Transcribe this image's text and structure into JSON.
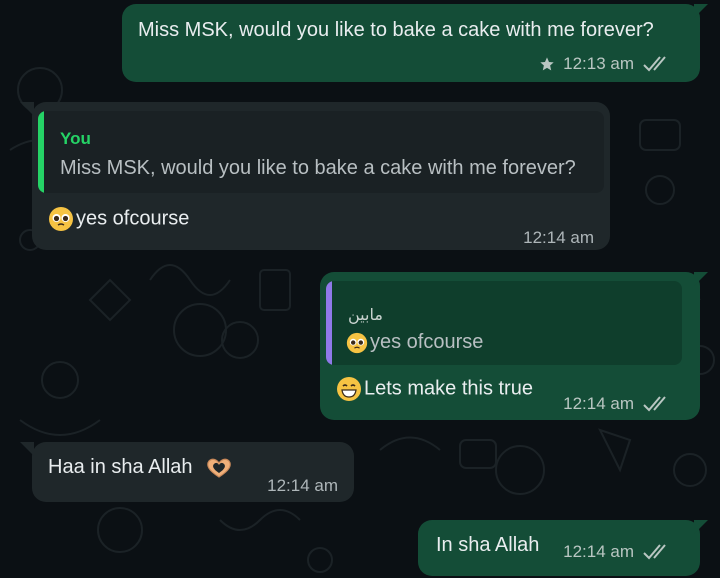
{
  "colors": {
    "outgoing_bubble": "#144d37",
    "incoming_bubble": "#1f272a",
    "background": "#0b1014",
    "quote_you_accent": "#25d366",
    "quote_contact_accent": "#8f79e8"
  },
  "messages": [
    {
      "direction": "outgoing",
      "text": "Miss MSK, would you like to bake a cake with me forever?",
      "time": "12:13 am",
      "starred": true,
      "status_icon": "double-check-icon"
    },
    {
      "direction": "incoming",
      "quote": {
        "author": "You",
        "text": "Miss MSK, would you like to bake a cake with me forever?"
      },
      "emoji": "pleading-face-emoji",
      "text": "yes ofcourse",
      "time": "12:14 am"
    },
    {
      "direction": "outgoing",
      "quote": {
        "author": "مابين",
        "emoji": "pleading-face-emoji",
        "text": "yes ofcourse"
      },
      "emoji": "grinning-face-emoji",
      "text": "Lets make this true",
      "time": "12:14 am",
      "status_icon": "double-check-icon"
    },
    {
      "direction": "incoming",
      "text": "Haa in sha Allah",
      "emoji": "heart-hands-emoji",
      "time": "12:14 am"
    },
    {
      "direction": "outgoing",
      "text": "In sha Allah",
      "time": "12:14 am",
      "status_icon": "double-check-icon"
    }
  ]
}
